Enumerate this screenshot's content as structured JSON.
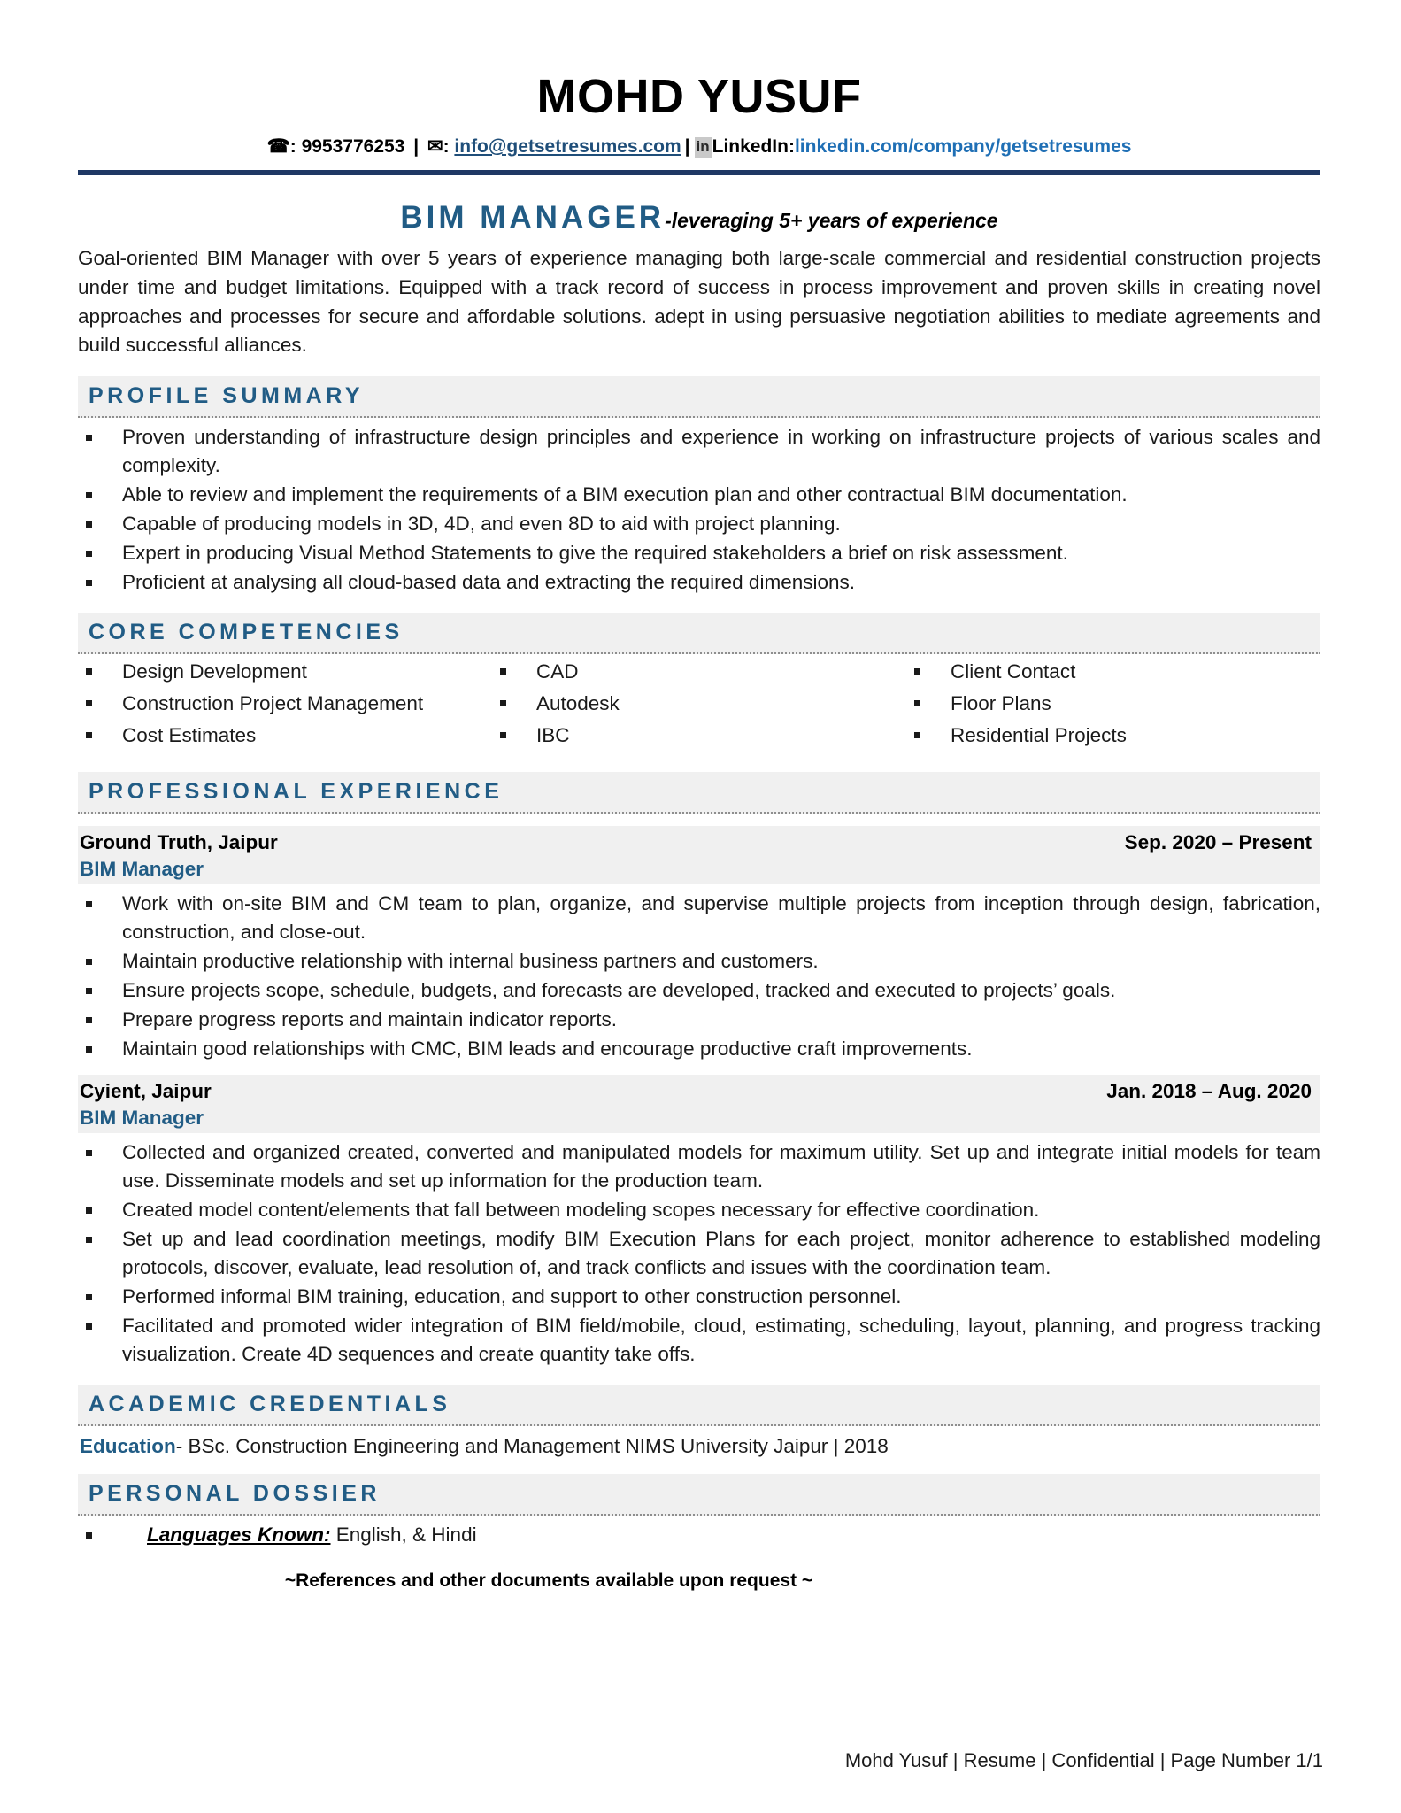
{
  "header": {
    "name": "MOHD YUSUF",
    "phone_icon": "phone-icon",
    "phone": "9953776253",
    "separator": "|",
    "email_icon": "envelope-icon",
    "email": "info@getsetresumes.com",
    "linkedin_icon": "linkedin-icon",
    "linkedin_icon_text": "in",
    "linkedin_label": "LinkedIn:",
    "linkedin_url": "linkedin.com/company/getsetresumes"
  },
  "title": {
    "role": "BIM MANAGER",
    "tagline": "-leveraging 5+ years of experience",
    "summary": "Goal-oriented BIM Manager with over 5 years of experience managing both large-scale commercial and residential construction projects under time and budget limitations. Equipped with a track record of success in process improvement and proven skills in creating novel approaches and processes for secure and affordable solutions. adept in using persuasive negotiation abilities to mediate agreements and build successful alliances."
  },
  "profile_summary": {
    "heading": "PROFILE SUMMARY",
    "bullets": [
      "Proven understanding of infrastructure design principles and experience in working on infrastructure projects of various scales and complexity.",
      "Able to review and implement the requirements of a BIM execution plan and other contractual BIM documentation.",
      "Capable of producing models in 3D, 4D, and even 8D to aid with project planning.",
      "Expert in producing Visual Method Statements to give the required stakeholders a brief on risk assessment.",
      "Proficient at analysing all cloud-based data and extracting the required dimensions."
    ]
  },
  "core_competencies": {
    "heading": "CORE COMPETENCIES",
    "items": [
      "Design Development",
      "CAD",
      "Client Contact",
      "Construction Project Management",
      "Autodesk",
      "Floor Plans",
      "Cost Estimates",
      "IBC",
      "Residential Projects"
    ]
  },
  "professional_experience": {
    "heading": "PROFESSIONAL EXPERIENCE",
    "jobs": [
      {
        "company": "Ground Truth, Jaipur",
        "dates": "Sep. 2020 – Present",
        "role": "BIM Manager",
        "bullets": [
          "Work with on-site BIM and CM team to plan, organize, and supervise multiple projects from inception through design, fabrication, construction, and close-out.",
          "Maintain productive relationship with internal business partners and customers.",
          "Ensure projects scope, schedule, budgets, and forecasts are developed, tracked and executed to projects’ goals.",
          "Prepare progress reports and maintain indicator reports.",
          "Maintain good relationships with CMC, BIM leads and encourage productive craft improvements."
        ]
      },
      {
        "company": "Cyient, Jaipur",
        "dates": "Jan. 2018 – Aug. 2020",
        "role": "BIM Manager",
        "bullets": [
          "Collected and organized created, converted and manipulated models for maximum utility. Set up and integrate initial models for team use. Disseminate models and set up information for the production team.",
          "Created model content/elements that fall between modeling scopes necessary for effective coordination.",
          "Set up and lead coordination meetings, modify BIM Execution Plans for each project, monitor adherence to established modeling protocols, discover, evaluate, lead resolution of, and track conflicts and issues with the coordination team.",
          "Performed informal BIM training, education, and support to other construction personnel.",
          "Facilitated and promoted wider integration of BIM field/mobile, cloud, estimating, scheduling, layout, planning, and progress tracking visualization. Create 4D sequences and create quantity take offs."
        ]
      }
    ]
  },
  "academic_credentials": {
    "heading": "ACADEMIC CREDENTIALS",
    "education_label": "Education",
    "education_text": "- BSc. Construction Engineering and Management NIMS University Jaipur | 2018"
  },
  "personal_dossier": {
    "heading": "PERSONAL DOSSIER",
    "languages_label": "Languages Known:",
    "languages_value": " English, & Hindi"
  },
  "references_note": "~References and other documents available upon request ~",
  "footer": {
    "text": "Mohd Yusuf | Resume | Confidential | Page Number 1/1"
  },
  "colors": {
    "accent_blue": "#215C85",
    "rule_navy": "#1F3864",
    "link_blue": "#1F4E79",
    "url_blue": "#1F6FB5",
    "band_gray": "#F0F0F0"
  }
}
